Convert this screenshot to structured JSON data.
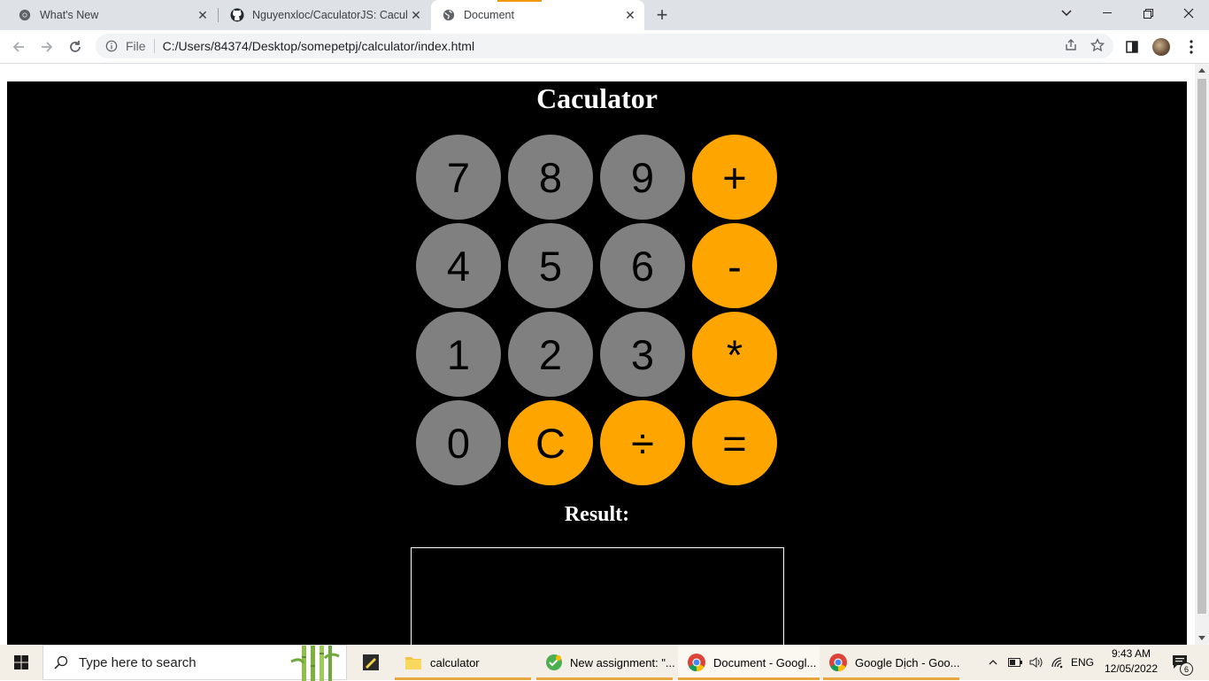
{
  "browser": {
    "tabs": [
      {
        "title": "What's New",
        "icon": "chrome-icon",
        "active": false
      },
      {
        "title": "Nguyenxloc/CaculatorJS: Caculat",
        "icon": "github-icon",
        "active": false
      },
      {
        "title": "Document",
        "icon": "globe-icon",
        "active": true
      }
    ],
    "address": {
      "scheme_label": "File",
      "url": "C:/Users/84374/Desktop/somepetpj/calculator/index.html"
    }
  },
  "page": {
    "title": "Caculator",
    "keys": [
      [
        "7",
        "8",
        "9",
        "+"
      ],
      [
        "4",
        "5",
        "6",
        "-"
      ],
      [
        "1",
        "2",
        "3",
        "*"
      ],
      [
        "0",
        "C",
        "÷",
        "="
      ]
    ],
    "result_label": "Result:",
    "result_value": ""
  },
  "taskbar": {
    "search_placeholder": "Type here to search",
    "apps": [
      {
        "label": "calculator",
        "icon": "folder-icon"
      },
      {
        "label": "New assignment: \"...",
        "icon": "classroom-icon"
      },
      {
        "label": "Document - Googl...",
        "icon": "chrome-icon",
        "active": true
      },
      {
        "label": "Google Dịch - Goo...",
        "icon": "chrome-icon"
      }
    ],
    "language": "ENG",
    "time": "9:43 AM",
    "date": "12/05/2022",
    "notification_count": "6"
  },
  "colors": {
    "number_key": "#808080",
    "operator_key": "#ffa500",
    "app_background": "#000000"
  }
}
